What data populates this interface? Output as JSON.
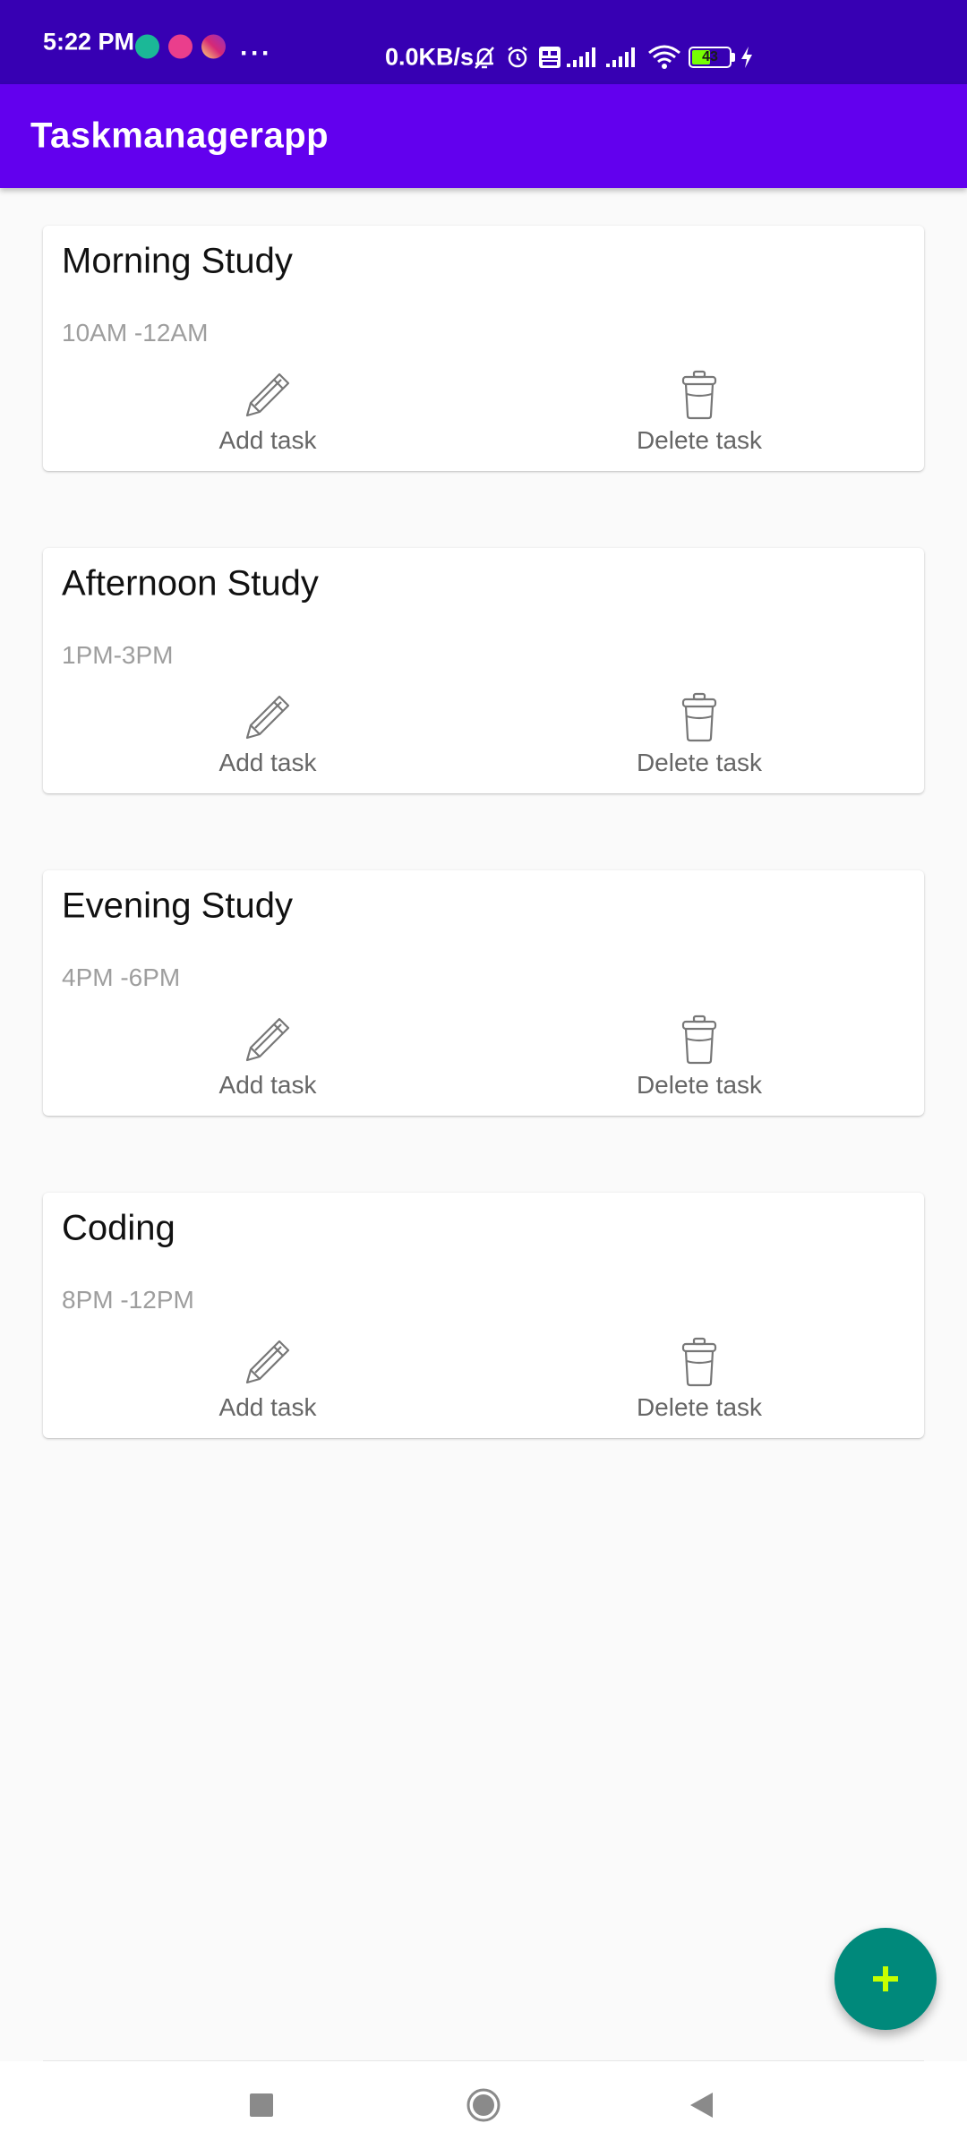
{
  "status_bar": {
    "time": "5:22 PM",
    "app_icons": [
      {
        "name": "app-notification-icon-1",
        "color": "#1bb897"
      },
      {
        "name": "app-notification-icon-2",
        "color": "#ea3e8c"
      },
      {
        "name": "instagram-icon",
        "color": "#d6249f"
      }
    ],
    "more": "···",
    "network_speed": "0.0KB/s",
    "battery_level": "43"
  },
  "app_bar": {
    "title": "Taskmanagerapp"
  },
  "tasks": [
    {
      "title": "Morning Study",
      "time": "10AM -12AM",
      "add_label": "Add task",
      "delete_label": "Delete task"
    },
    {
      "title": "Afternoon Study",
      "time": "1PM-3PM",
      "add_label": "Add task",
      "delete_label": "Delete task"
    },
    {
      "title": "Evening Study",
      "time": "4PM -6PM",
      "add_label": "Add task",
      "delete_label": "Delete task"
    },
    {
      "title": "Coding",
      "time": "8PM -12PM",
      "add_label": "Add task",
      "delete_label": "Delete task"
    }
  ],
  "fab": {
    "icon": "plus-icon",
    "color": "#00897b",
    "icon_color": "#c6ff00"
  },
  "nav": {
    "items": [
      "recents-square-icon",
      "home-circle-icon",
      "back-triangle-icon"
    ]
  },
  "colors": {
    "status_bar": "#3700b3",
    "app_bar": "#6200ee",
    "background": "#fafafa"
  }
}
